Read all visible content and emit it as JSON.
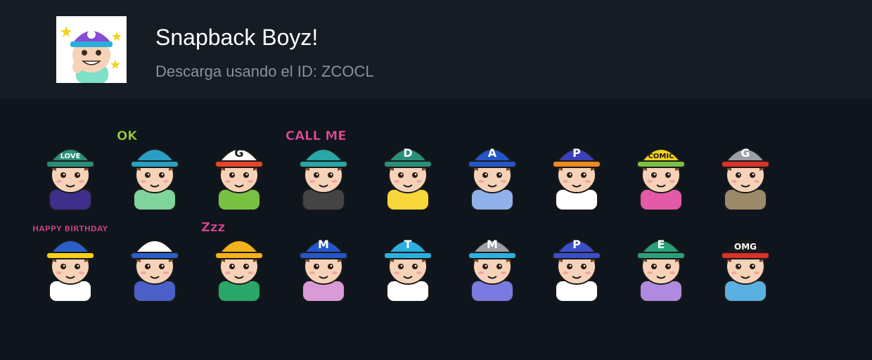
{
  "pack": {
    "title": "Snapback Boyz!",
    "subtitle": "Descarga usando el ID: ZCOCL",
    "thumbnail": {
      "cap_color": "#8a4bd6",
      "cap_letter": ""
    }
  },
  "stickers_row1": [
    {
      "cap": "#2a8f7a",
      "brim": "#2a8f7a",
      "letter": "LOVE",
      "shirt": "#3d2f8a",
      "caption": ""
    },
    {
      "cap": "#2a9fc4",
      "brim": "#2a9fc4",
      "letter": "",
      "shirt": "#7fd39b",
      "caption": "OK"
    },
    {
      "cap": "#ffffff",
      "brim": "#e8442a",
      "letter": "G",
      "shirt": "#7ac043",
      "caption": ""
    },
    {
      "cap": "#2aa6a6",
      "brim": "#2aa6a6",
      "letter": "",
      "shirt": "#444444",
      "caption": "CALL ME"
    },
    {
      "cap": "#2a8f7a",
      "brim": "#2a8f7a",
      "letter": "D",
      "shirt": "#f7d63a",
      "caption": ""
    },
    {
      "cap": "#2457c8",
      "brim": "#2457c8",
      "letter": "A",
      "shirt": "#8fb0e8",
      "caption": ""
    },
    {
      "cap": "#3b3fb8",
      "brim": "#f08a1e",
      "letter": "P",
      "shirt": "#ffffff",
      "caption": ""
    },
    {
      "cap": "#f5d21a",
      "brim": "#7ac043",
      "letter": "COMIC",
      "shirt": "#e25aa8",
      "caption": ""
    },
    {
      "cap": "#9aa0a6",
      "brim": "#d8322a",
      "letter": "G",
      "shirt": "#9a8a6a",
      "caption": ""
    }
  ],
  "stickers_row2": [
    {
      "cap": "#2a5fc8",
      "brim": "#f5d21a",
      "letter": "",
      "shirt": "#ffffff",
      "caption": "HAPPY BIRTHDAY"
    },
    {
      "cap": "#ffffff",
      "brim": "#2a5fc8",
      "letter": "",
      "shirt": "#4b5fc8",
      "caption": ""
    },
    {
      "cap": "#f5b21a",
      "brim": "#f5b21a",
      "letter": "",
      "shirt": "#2aa66a",
      "caption": "Zzz"
    },
    {
      "cap": "#2457c8",
      "brim": "#2457c8",
      "letter": "M",
      "shirt": "#d99ad8",
      "caption": ""
    },
    {
      "cap": "#2ab0e0",
      "brim": "#2ab0e0",
      "letter": "T",
      "shirt": "#ffffff",
      "caption": ""
    },
    {
      "cap": "#9aa0a6",
      "brim": "#2ab0e0",
      "letter": "M",
      "shirt": "#7a7ae0",
      "caption": ""
    },
    {
      "cap": "#3b4fc8",
      "brim": "#3b4fc8",
      "letter": "P",
      "shirt": "#ffffff",
      "caption": ""
    },
    {
      "cap": "#2a9f7a",
      "brim": "#2a9f7a",
      "letter": "E",
      "shirt": "#b08ae0",
      "caption": ""
    },
    {
      "cap": "#1a1a1a",
      "brim": "#d8322a",
      "letter": "OMG",
      "shirt": "#5ab0e0",
      "caption": ""
    }
  ]
}
